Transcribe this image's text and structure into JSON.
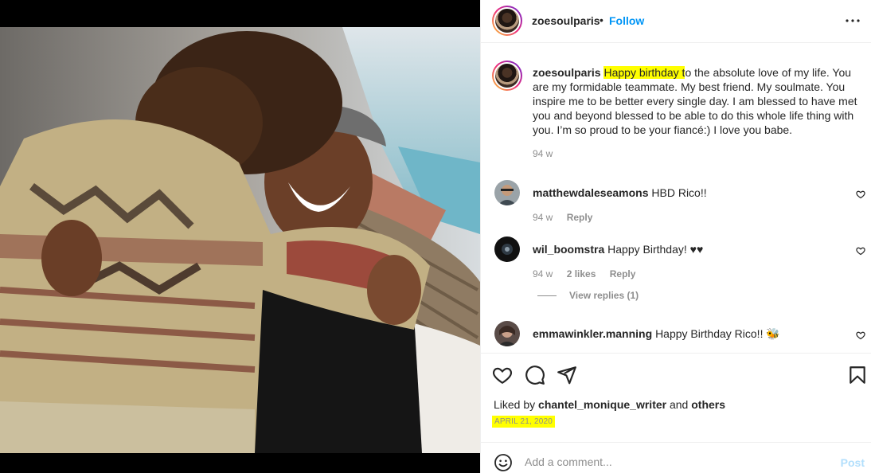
{
  "post": {
    "username": "zoesoulparis",
    "follow_label": "Follow",
    "more_icon": "more-horizontal-icon"
  },
  "caption": {
    "username": "zoesoulparis",
    "highlight": "Happy birthday t",
    "rest": "o the absolute love of my life. You are my formidable teammate. My best friend. My soulmate. You inspire me to be better every single day. I am blessed to have met you and beyond blessed to be able to do this whole life thing with you. I’m so proud to be your fiancé:) I love you babe.",
    "time": "94 w"
  },
  "comments": [
    {
      "username": "matthewdaleseamons",
      "text": "HBD Rico!!",
      "time": "94 w",
      "likes": "",
      "reply_label": "Reply"
    },
    {
      "username": "wil_boomstra",
      "text": "Happy Birthday! ♥♥",
      "time": "94 w",
      "likes": "2 likes",
      "reply_label": "Reply"
    },
    {
      "username": "emmawinkler.manning",
      "text": "Happy Birthday Rico!! 🐝",
      "time": "",
      "likes": "",
      "reply_label": ""
    }
  ],
  "view_replies_label": "View replies (1)",
  "liked_by": {
    "prefix": "Liked by",
    "user": "chantel_monique_writer",
    "and": "and",
    "others": "others"
  },
  "date": "APRIL 21, 2020",
  "add_comment": {
    "placeholder": "Add a comment...",
    "post_label": "Post"
  },
  "colors": {
    "accent": "#0095f6",
    "highlight": "#ffff00",
    "muted": "#8e8e8e",
    "post_disabled": "#b2dffc"
  }
}
